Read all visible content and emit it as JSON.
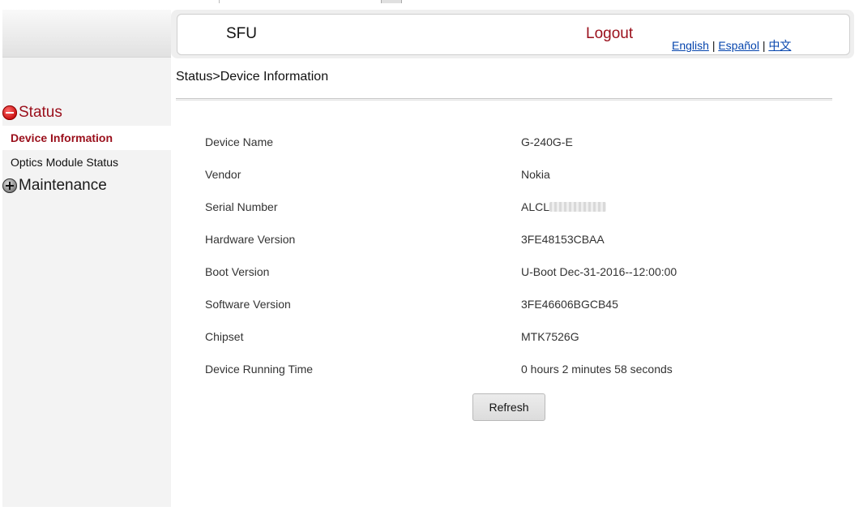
{
  "header": {
    "brand": "SFU",
    "logout_label": "Logout",
    "languages": [
      "English",
      "Español",
      "中文"
    ],
    "lang_separator": "|"
  },
  "sidebar": {
    "groups": [
      {
        "label": "Status",
        "state": "expanded",
        "icon": "collapse-minus-icon",
        "items": [
          {
            "label": "Device Information",
            "active": true
          },
          {
            "label": "Optics Module Status",
            "active": false
          }
        ]
      },
      {
        "label": "Maintenance",
        "state": "collapsed",
        "icon": "expand-plus-icon",
        "items": []
      }
    ]
  },
  "main": {
    "breadcrumb": "Status>Device Information",
    "rows": [
      {
        "label": "Device Name",
        "value": "G-240G-E"
      },
      {
        "label": "Vendor",
        "value": "Nokia"
      },
      {
        "label": "Serial Number",
        "value": "ALCL",
        "value_redacted": true
      },
      {
        "label": "Hardware Version",
        "value": "3FE48153CBAA"
      },
      {
        "label": "Boot Version",
        "value": "U-Boot Dec-31-2016--12:00:00"
      },
      {
        "label": "Software Version",
        "value": "3FE46606BGCB45"
      },
      {
        "label": "Chipset",
        "value": "MTK7526G"
      },
      {
        "label": "Device Running Time",
        "value": "0 hours 2 minutes 58 seconds"
      }
    ],
    "refresh_label": "Refresh"
  },
  "colors": {
    "accent": "#9a0f1b",
    "link": "#0645ad",
    "sidebar_bg": "#f3f3f3"
  }
}
